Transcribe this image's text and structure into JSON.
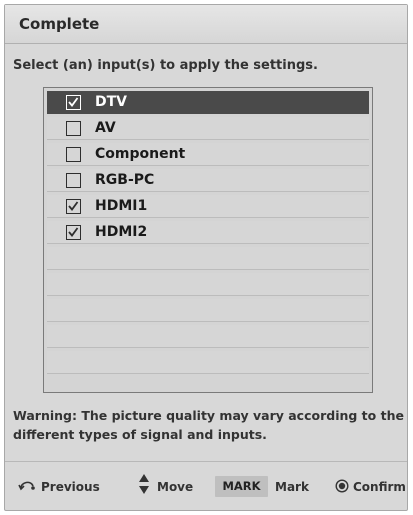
{
  "dialog": {
    "title": "Complete",
    "instruction": "Select (an) input(s) to apply the settings."
  },
  "inputs": [
    {
      "label": "DTV",
      "checked": true,
      "selected": true
    },
    {
      "label": "AV",
      "checked": false,
      "selected": false
    },
    {
      "label": "Component",
      "checked": false,
      "selected": false
    },
    {
      "label": "RGB-PC",
      "checked": false,
      "selected": false
    },
    {
      "label": "HDMI1",
      "checked": true,
      "selected": false
    },
    {
      "label": "HDMI2",
      "checked": true,
      "selected": false
    }
  ],
  "warning": "Warning: The picture quality may vary according to the different types of signal and inputs.",
  "footer": {
    "previous_label": "Previous",
    "move_label": "Move",
    "mark_key": "MARK",
    "mark_label": "Mark",
    "confirm_label": "Confirm"
  },
  "icons": {
    "previous": "return-arrow-icon",
    "move": "up-down-arrows-icon",
    "confirm": "ok-circle-icon",
    "checkbox": "checkbox-icon"
  },
  "colors": {
    "background": "#d8d8d8",
    "selected_row": "#4a4a4a",
    "selected_text": "#ffffff"
  }
}
